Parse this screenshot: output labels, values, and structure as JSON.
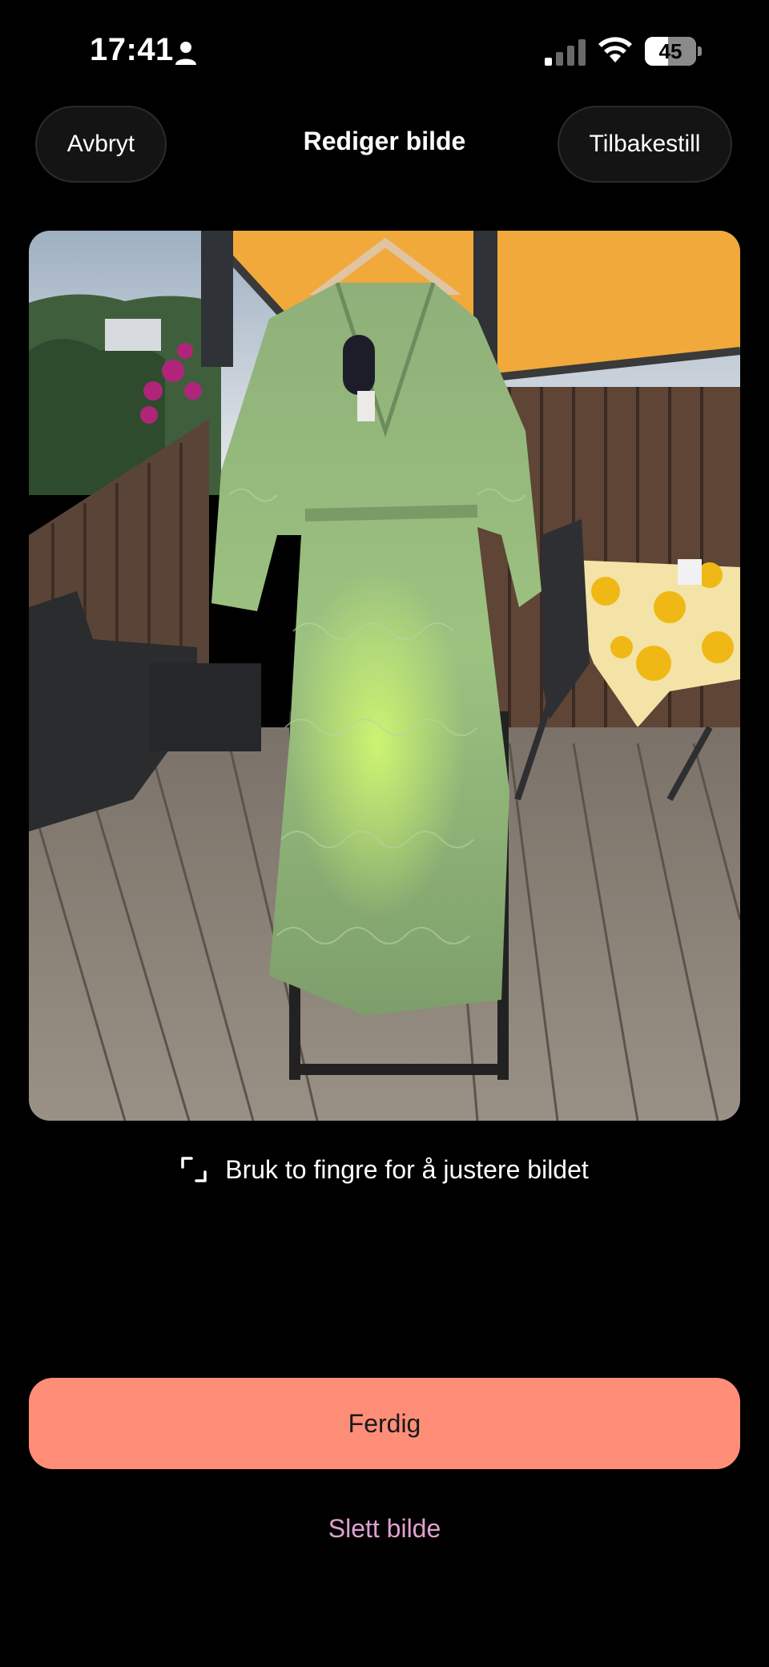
{
  "status_bar": {
    "time": "17:41",
    "battery": "45"
  },
  "header": {
    "title": "Rediger bilde",
    "cancel_label": "Avbryt",
    "reset_label": "Tilbakestill"
  },
  "hint": {
    "text": "Bruk to fingre for å justere bildet",
    "icon": "crop-corners-icon"
  },
  "actions": {
    "done_label": "Ferdig",
    "delete_label": "Slett bilde"
  },
  "colors": {
    "background": "#000000",
    "primary_button": "#FF8E78",
    "delete_link": "#E0A0D2"
  }
}
